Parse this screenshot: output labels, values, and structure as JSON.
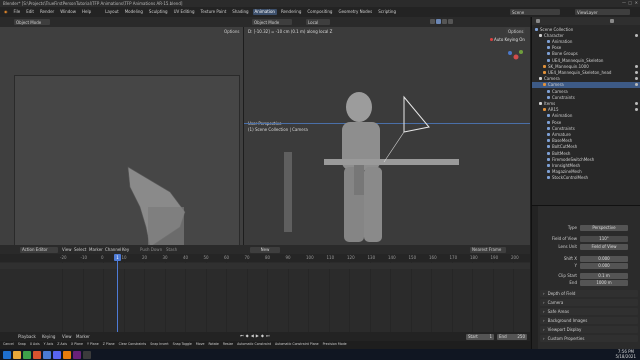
{
  "title": "Blender* [S:\\Projects\\TrueFirstPersonTutorial\\TFP Animations\\TFP Animations AR-15.blend]",
  "menu": [
    "File",
    "Edit",
    "Render",
    "Window",
    "Help"
  ],
  "workspaces": [
    "Layout",
    "Modeling",
    "Sculpting",
    "UV Editing",
    "Texture Paint",
    "Shading",
    "Animation",
    "Rendering",
    "Compositing",
    "Geometry Nodes",
    "Scripting"
  ],
  "active_workspace": "Animation",
  "scene_label": "Scene",
  "viewlayer_label": "ViewLayer",
  "left_viewport": {
    "mode": "Object Mode",
    "options": "Options"
  },
  "main_viewport": {
    "orientation": "Local",
    "title": "User Perspective",
    "subtitle": "(1) Scene Collection | Camera",
    "options": "Options",
    "auto_keying": "Auto Keying On",
    "hud": "D: [-10.32] = -10 cm (0.1 m) along local Z"
  },
  "timeline": {
    "editor": "Action Editor",
    "menus": [
      "View",
      "Select",
      "Marker",
      "Channel",
      "Key"
    ],
    "push_down": "Push Down",
    "stash": "Stash",
    "new": "New",
    "nearest_frame": "Nearest Frame",
    "ticks": [
      "-20",
      "-10",
      "0",
      "10",
      "20",
      "30",
      "40",
      "50",
      "60",
      "70",
      "80",
      "90",
      "100",
      "110",
      "120",
      "130",
      "140",
      "150",
      "160",
      "170",
      "180",
      "190",
      "200"
    ],
    "current_frame": "1"
  },
  "playbar": {
    "items": [
      "Playback",
      "Keying",
      "View",
      "Marker"
    ],
    "start_label": "Start",
    "start": "1",
    "end_label": "End",
    "end": "250"
  },
  "status": [
    "Cancel",
    "Snap",
    "X Axis",
    "Y Axis",
    "Z Axis",
    "X Plane",
    "Y Plane",
    "Z Plane",
    "Clear Constraints",
    "Snap Invert",
    "Snap Toggle",
    "Move",
    "Rotate",
    "Resize",
    "Automatic Constraint",
    "Automatic Constraint Plane",
    "Precision Mode"
  ],
  "outliner": [
    {
      "label": "Scene Collection",
      "indent": 0
    },
    {
      "label": "Character",
      "indent": 1
    },
    {
      "label": "Animation",
      "indent": 3
    },
    {
      "label": "Pose",
      "indent": 3
    },
    {
      "label": "Bone Groups",
      "indent": 3
    },
    {
      "label": "UE4_Mannequin_Skeleton",
      "indent": 3
    },
    {
      "label": "SK_Mannequin.1000",
      "indent": 2
    },
    {
      "label": "UE4_Mannequin_Skeleton_head",
      "indent": 2
    },
    {
      "label": "Camera",
      "indent": 1
    },
    {
      "label": "Camera",
      "indent": 2,
      "selected": true
    },
    {
      "label": "Camera",
      "indent": 3
    },
    {
      "label": "Constraints",
      "indent": 3
    },
    {
      "label": "Items",
      "indent": 1
    },
    {
      "label": "AR15",
      "indent": 2
    },
    {
      "label": "Animation",
      "indent": 3
    },
    {
      "label": "Pose",
      "indent": 3
    },
    {
      "label": "Constraints",
      "indent": 3
    },
    {
      "label": "Armature",
      "indent": 3
    },
    {
      "label": "BaseMesh",
      "indent": 3
    },
    {
      "label": "BoltCutMesh",
      "indent": 3
    },
    {
      "label": "BoltMesh",
      "indent": 3
    },
    {
      "label": "FiremodeSwitchMesh",
      "indent": 3
    },
    {
      "label": "IronsightMesh",
      "indent": 3
    },
    {
      "label": "MagazineMesh",
      "indent": 3
    },
    {
      "label": "StockControlMesh",
      "indent": 3
    }
  ],
  "properties": {
    "type_label": "Type",
    "type_value": "Perspective",
    "fov_label": "Field of View",
    "fov_value": "110°",
    "lens_label": "Lens Unit",
    "lens_value": "Field of View",
    "shiftx_label": "Shift X",
    "shiftx_value": "0.000",
    "shifty_label": "Y",
    "shifty_value": "0.000",
    "clipstart_label": "Clip Start",
    "clipstart_value": "0.1 m",
    "clipend_label": "End",
    "clipend_value": "1000 m",
    "sections": [
      "Depth of Field",
      "Camera",
      "Safe Areas",
      "Background Images",
      "Viewport Display",
      "Custom Properties"
    ]
  },
  "taskbar": {
    "time": "7:56 PM",
    "date": "5/18/2021"
  },
  "colors": {
    "accent": "#4772b3",
    "active_ws": "#3c4f6b",
    "selection": "#3d5a86",
    "playhead": "#4e7bd6"
  }
}
